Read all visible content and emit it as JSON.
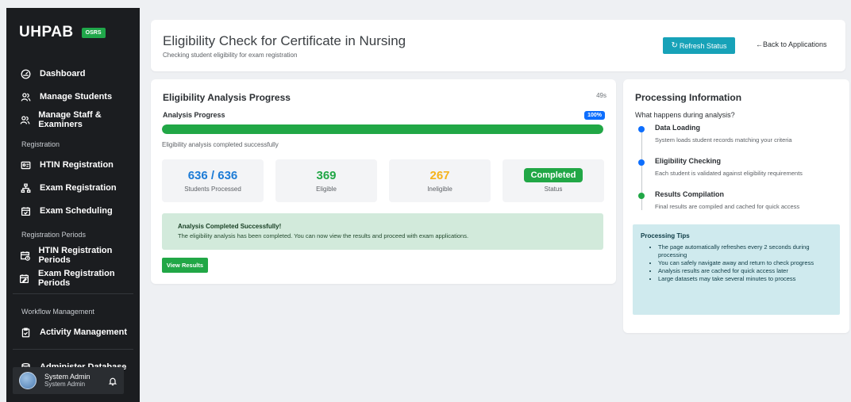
{
  "brand": {
    "name": "UHPAB",
    "badge": "OSRS"
  },
  "sidebar": {
    "items": [
      {
        "label": "Dashboard",
        "icon": "dashboard-icon"
      },
      {
        "label": "Manage Students",
        "icon": "users-icon"
      },
      {
        "label": "Manage Staff & Examiners",
        "icon": "users-icon"
      },
      {
        "label": "HTIN Registration",
        "icon": "id-card-icon"
      },
      {
        "label": "Exam Registration",
        "icon": "sitemap-icon"
      },
      {
        "label": "Exam Scheduling",
        "icon": "calendar-check-icon"
      },
      {
        "label": "HTIN Registration Periods",
        "icon": "calendar-clock-icon"
      },
      {
        "label": "Exam Registration Periods",
        "icon": "calendar-edit-icon"
      },
      {
        "label": "Activity Management",
        "icon": "clipboard-icon"
      },
      {
        "label": "Administer Database",
        "icon": "database-icon"
      }
    ],
    "sections": {
      "registration": "Registration",
      "periods": "Registration Periods",
      "workflow": "Workflow Management"
    },
    "user": {
      "name": "System Admin",
      "role": "System Admin"
    }
  },
  "header": {
    "title": "Eligibility Check for Certificate in Nursing",
    "subtitle": "Checking student eligibility for exam registration",
    "refresh_label": "Refresh Status",
    "back_label": "Back to Applications"
  },
  "analysis": {
    "title": "Eligibility Analysis Progress",
    "timer": "49s",
    "progress_label": "Analysis Progress",
    "percent_label": "100%",
    "percent": 100,
    "message": "Eligibility analysis completed successfully",
    "stats": {
      "processed_value": "636 / 636",
      "processed_caption": "Students Processed",
      "eligible_value": "369",
      "eligible_caption": "Eligible",
      "ineligible_value": "267",
      "ineligible_caption": "Ineligible",
      "status_value": "Completed",
      "status_caption": "Status"
    },
    "alert_title": "Analysis Completed Successfully!",
    "alert_text": "The eligibility analysis has been completed. You can now view the results and proceed with exam applications.",
    "view_results_label": "View Results"
  },
  "info": {
    "title": "Processing Information",
    "question": "What happens during analysis?",
    "steps": [
      {
        "title": "Data Loading",
        "desc": "System loads student records matching your criteria",
        "color": "#0d6efd"
      },
      {
        "title": "Eligibility Checking",
        "desc": "Each student is validated against eligibility requirements",
        "color": "#0d6efd"
      },
      {
        "title": "Results Compilation",
        "desc": "Final results are compiled and cached for quick access",
        "color": "#21a746"
      }
    ],
    "tips_title": "Processing Tips",
    "tips": [
      "The page automatically refreshes every 2 seconds during processing",
      "You can safely navigate away and return to check progress",
      "Analysis results are cached for quick access later",
      "Large datasets may take several minutes to process"
    ]
  },
  "colors": {
    "sidebar_bg": "#1b1d20",
    "accent_teal": "#17a2b8",
    "success": "#21a746",
    "primary": "#0d6efd",
    "eligible_text": "#21a746",
    "ineligible_text": "#f5b31c",
    "processed_text": "#1c7bd6"
  }
}
